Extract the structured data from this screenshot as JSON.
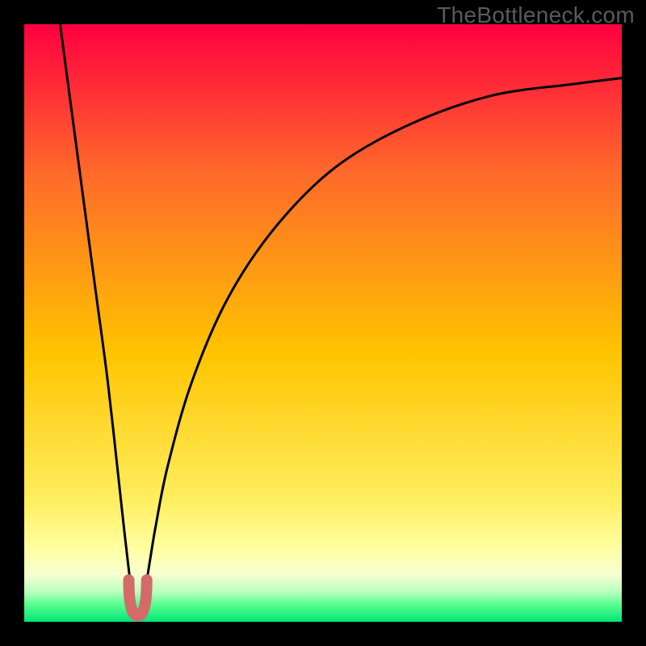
{
  "watermark": "TheBottleneck.com",
  "gradient_stops": [
    {
      "pct": 0,
      "color": "#ff0040"
    },
    {
      "pct": 25,
      "color": "#ff6a2a"
    },
    {
      "pct": 55,
      "color": "#ffc400"
    },
    {
      "pct": 80,
      "color": "#ffef60"
    },
    {
      "pct": 88,
      "color": "#ffffa5"
    },
    {
      "pct": 92,
      "color": "#f8ffd0"
    },
    {
      "pct": 95,
      "color": "#baffc0"
    },
    {
      "pct": 97,
      "color": "#5cff90"
    },
    {
      "pct": 100,
      "color": "#00e676"
    }
  ],
  "curve_style": {
    "stroke": "#000000",
    "stroke_width": 3,
    "marker_stroke": "#d46a6a",
    "marker_stroke_width": 14
  },
  "chart_data": {
    "type": "line",
    "title": "",
    "xlabel": "",
    "ylabel": "",
    "xlim": [
      0,
      100
    ],
    "ylim": [
      0,
      100
    ],
    "grid": false,
    "notes": "Single black curve resembling |bottleneck%| vs hardware ratio. Minimum at x≈19 where the curve dips to ~1%, marked with a thick salmon U-shaped highlight. No axis ticks or labels are rendered in the image; values below are read visually from the 0–100 normalized plot area.",
    "series": [
      {
        "name": "bottleneck-curve",
        "x": [
          6,
          8,
          10,
          12,
          14,
          16,
          17,
          18,
          19,
          20,
          21,
          22,
          24,
          28,
          34,
          42,
          52,
          64,
          78,
          92,
          100
        ],
        "y": [
          100,
          85,
          70,
          55,
          40,
          22,
          13,
          5,
          1,
          4,
          10,
          16,
          26,
          40,
          54,
          66,
          76,
          83,
          88,
          90,
          91
        ]
      }
    ],
    "marker": {
      "description": "U-shaped salmon highlight at the curve minimum",
      "x_range": [
        17.5,
        20.5
      ],
      "y_range": [
        1,
        7
      ]
    }
  }
}
